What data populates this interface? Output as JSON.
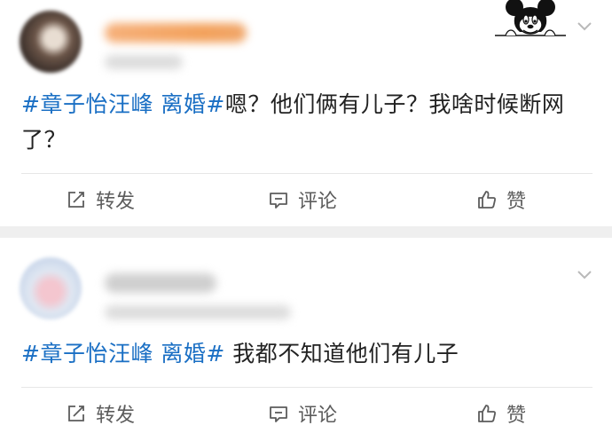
{
  "posts": [
    {
      "hashtag": "#章子怡汪峰 离婚#",
      "content": "嗯？他们俩有儿子？我啥时候断网",
      "content_line2": "了？",
      "actions": {
        "repost": "转发",
        "comment": "评论",
        "like": "赞"
      }
    },
    {
      "hashtag": "#章子怡汪峰 离婚#",
      "content": " 我都不知道他们有儿子",
      "actions": {
        "repost": "转发",
        "comment": "评论",
        "like": "赞"
      }
    }
  ],
  "colors": {
    "hashtag": "#1a6fc4",
    "text": "#222222",
    "action": "#5c5c5c",
    "separator": "#efefef"
  },
  "icons": {
    "repost": "edit-share-icon",
    "comment": "comment-bubble-icon",
    "like": "thumbs-up-icon",
    "menu": "chevron-down-icon",
    "decoration": "mickey-mouse-icon"
  }
}
